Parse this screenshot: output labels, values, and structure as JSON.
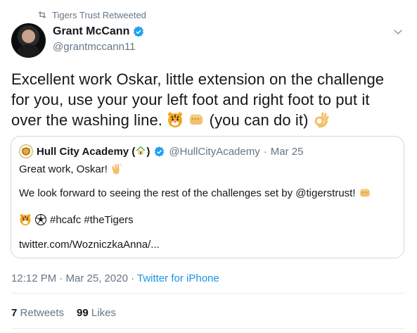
{
  "retweet": {
    "label": "Tigers Trust Retweeted",
    "icon": "retweet-icon"
  },
  "author": {
    "name": "Grant McCann",
    "handle": "@grantmccann11",
    "verified": true
  },
  "tweet": {
    "line1": "Excellent work Oskar, little extension on the challenge",
    "line2": "for you, use your your left foot and right foot to put it",
    "line3_a": "over the washing line.",
    "line3_b": "(you can do it)"
  },
  "quote": {
    "name": "Hull City Academy (",
    "name_close": ")",
    "handle": "@HullCityAcademy",
    "sep": "·",
    "date": "Mar 25",
    "line1": "Great work, Oskar!",
    "line2": "We look forward to seeing the rest of the challenges set by @tigerstrust!",
    "line3": "#hcafc #theTigers",
    "line4": "twitter.com/WozniczkaAnna/..."
  },
  "meta": {
    "time_date": "12:12 PM · Mar 25, 2020 ·",
    "source": "Twitter for iPhone"
  },
  "stats": {
    "retweets_count": "7",
    "retweets_label": "Retweets",
    "likes_count": "99",
    "likes_label": "Likes"
  },
  "colors": {
    "accent": "#1da1f2",
    "muted": "#657786",
    "link": "#1b95e0",
    "border": "#cfd9de"
  }
}
